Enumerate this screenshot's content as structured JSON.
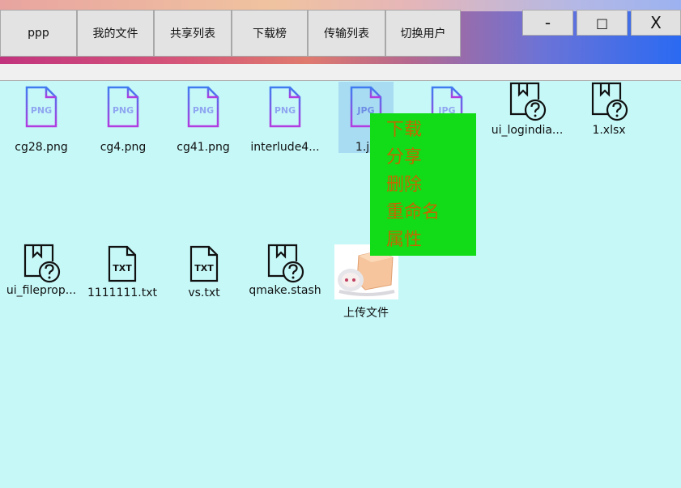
{
  "window": {
    "tabs": [
      "ppp",
      "我的文件",
      "共享列表",
      "下载榜",
      "传输列表",
      "切换用户"
    ],
    "controls": {
      "minimize": "-",
      "maximize": "□",
      "close": "X"
    }
  },
  "files": [
    {
      "name": "cg28.png",
      "icon": "png-file-icon"
    },
    {
      "name": "cg4.png",
      "icon": "png-file-icon"
    },
    {
      "name": "cg41.png",
      "icon": "png-file-icon"
    },
    {
      "name": "interlude4...",
      "icon": "png-file-icon"
    },
    {
      "name": "1.jp",
      "icon": "jpg-file-icon"
    },
    {
      "name": "",
      "icon": "jpg-file-icon"
    },
    {
      "name": "ui_logindia...",
      "icon": "unknown-file-icon"
    },
    {
      "name": "1.xlsx",
      "icon": "unknown-file-icon"
    },
    {
      "name": "ui_fileprop...",
      "icon": "unknown-file-icon"
    },
    {
      "name": "1111111.txt",
      "icon": "txt-file-icon"
    },
    {
      "name": "vs.txt",
      "icon": "txt-file-icon"
    },
    {
      "name": "qmake.stash",
      "icon": "unknown-file-icon"
    },
    {
      "name": "上传文件",
      "icon": "upload-thumbnail"
    }
  ],
  "context_menu": [
    "下载",
    "分享",
    "删除",
    "重命名",
    "属性"
  ],
  "colors": {
    "content_bg": "#c6f8f8",
    "menu_bg": "#12dc18",
    "menu_text": "#c06a00",
    "selection": "#a8dcf2"
  }
}
